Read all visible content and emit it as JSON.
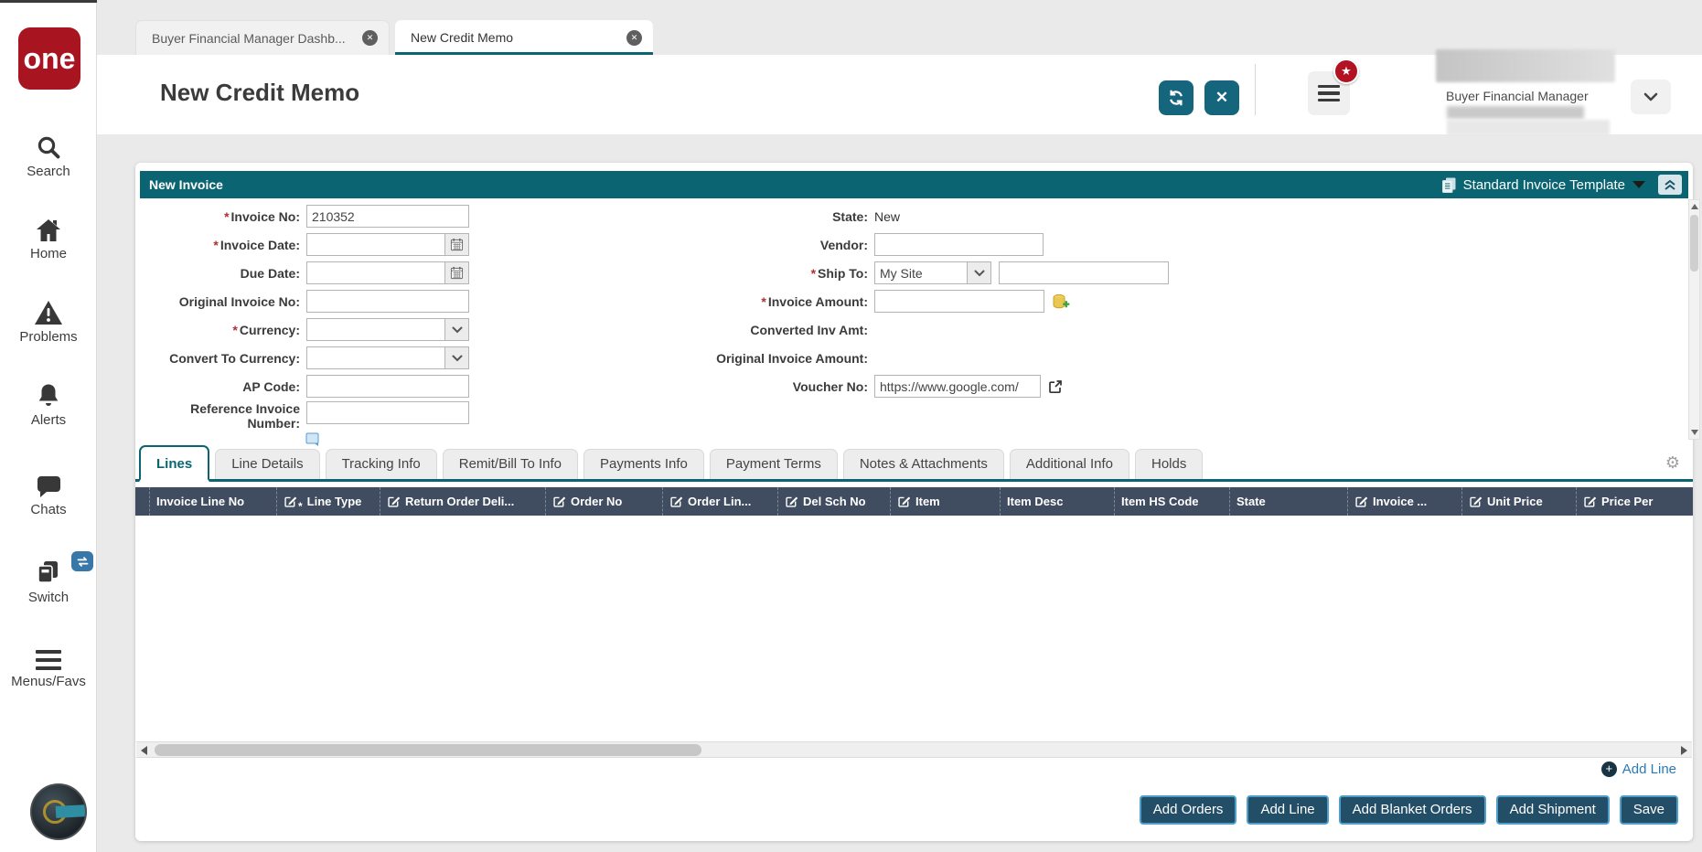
{
  "app": {
    "logo_text": "one"
  },
  "sidebar": {
    "items": [
      {
        "label": "Search"
      },
      {
        "label": "Home"
      },
      {
        "label": "Problems"
      },
      {
        "label": "Alerts"
      },
      {
        "label": "Chats"
      },
      {
        "label": "Switch"
      },
      {
        "label": "Menus/Favs"
      }
    ]
  },
  "tabstrip": {
    "tabs": [
      {
        "label": "Buyer Financial Manager Dashb..."
      },
      {
        "label": "New Credit Memo"
      }
    ]
  },
  "header": {
    "title": "New Credit Memo",
    "user_role": "Buyer Financial Manager"
  },
  "panel": {
    "title": "New Invoice",
    "template_label": "Standard Invoice Template"
  },
  "form": {
    "left": [
      {
        "label": "Invoice No:",
        "required": true,
        "value": "210352"
      },
      {
        "label": "Invoice Date:",
        "required": true,
        "value": ""
      },
      {
        "label": "Due Date:",
        "required": false,
        "value": ""
      },
      {
        "label": "Original Invoice No:",
        "required": false,
        "value": ""
      },
      {
        "label": "Currency:",
        "required": true,
        "value": ""
      },
      {
        "label": "Convert To Currency:",
        "required": false,
        "value": ""
      },
      {
        "label": "AP Code:",
        "required": false,
        "value": ""
      },
      {
        "label": "Reference Invoice Number:",
        "required": false,
        "value": ""
      }
    ],
    "right": [
      {
        "label": "State:",
        "value": "New"
      },
      {
        "label": "Vendor:",
        "value": ""
      },
      {
        "label": "Ship To:",
        "required": true,
        "select_value": "My Site",
        "value": ""
      },
      {
        "label": "Invoice Amount:",
        "required": true,
        "value": ""
      },
      {
        "label": "Converted Inv Amt:"
      },
      {
        "label": "Original Invoice Amount:"
      },
      {
        "label": "Voucher No:",
        "value": "https://www.google.com/"
      }
    ]
  },
  "subtabs": [
    {
      "label": "Lines"
    },
    {
      "label": "Line Details"
    },
    {
      "label": "Tracking Info"
    },
    {
      "label": "Remit/Bill To Info"
    },
    {
      "label": "Payments Info"
    },
    {
      "label": "Payment Terms"
    },
    {
      "label": "Notes & Attachments"
    },
    {
      "label": "Additional Info"
    },
    {
      "label": "Holds"
    }
  ],
  "lines_table": {
    "columns": [
      {
        "label": "Invoice Line No"
      },
      {
        "label": "Line Type"
      },
      {
        "label": "Return Order Deli..."
      },
      {
        "label": "Order No"
      },
      {
        "label": "Order Lin..."
      },
      {
        "label": "Del Sch No"
      },
      {
        "label": "Item"
      },
      {
        "label": "Item Desc"
      },
      {
        "label": "Item HS Code"
      },
      {
        "label": "State"
      },
      {
        "label": "Invoice ..."
      },
      {
        "label": "Unit Price"
      },
      {
        "label": "Price Per"
      }
    ]
  },
  "footer": {
    "add_line_link": "Add Line",
    "buttons": [
      {
        "label": "Add Orders"
      },
      {
        "label": "Add Line"
      },
      {
        "label": "Add Blanket Orders"
      },
      {
        "label": "Add Shipment"
      },
      {
        "label": "Save"
      }
    ]
  },
  "colors": {
    "teal": "#0b6472",
    "table_header_bg": "#404c60",
    "logo_red": "#a81420",
    "badge_red": "#b11322",
    "footer_button_bg": "#234e67",
    "footer_button_border": "#4e9fcc",
    "link_blue": "#2a7bb5"
  }
}
